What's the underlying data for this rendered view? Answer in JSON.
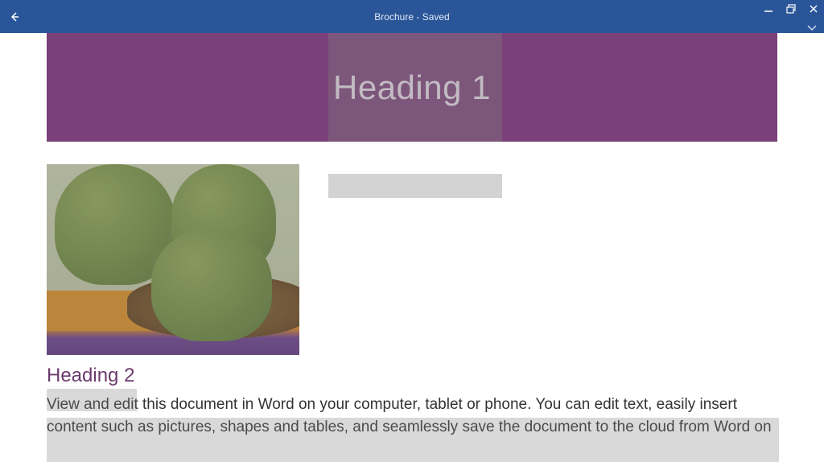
{
  "titlebar": {
    "title": "Brochure - Saved"
  },
  "document": {
    "heading1": "Heading 1",
    "heading2": "Heading 2",
    "body_text": "View and edit this document in Word on your computer, tablet or phone. You can edit text, easily insert content such as pictures, shapes and tables, and seamlessly save the document to the cloud from Word on"
  },
  "icons": {
    "back": "←",
    "minimize": "—",
    "restore": "❐",
    "close": "✕",
    "chevron": "⌄"
  },
  "colors": {
    "titlebar": "#2a5699",
    "hero_bg": "#7b3f7a",
    "heading2": "#6b3a6b"
  }
}
